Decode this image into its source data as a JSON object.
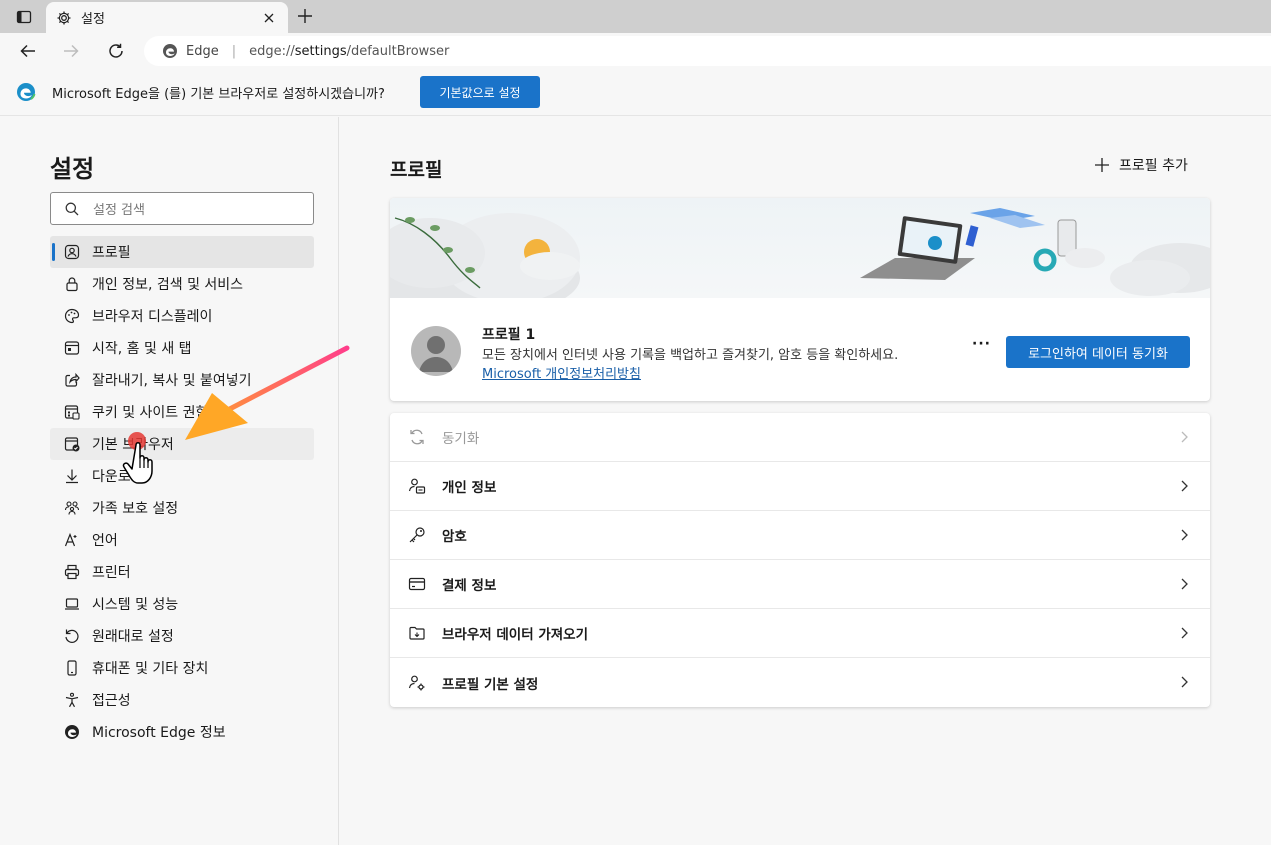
{
  "tab": {
    "title": "설정"
  },
  "address": {
    "brand": "Edge",
    "separator": "|",
    "url_prefix": "edge://",
    "url_host": "settings",
    "url_path": "/defaultBrowser"
  },
  "infobar": {
    "message": "Microsoft Edge을 (를) 기본 브라우저로 설정하시겠습니까?",
    "button": "기본값으로 설정"
  },
  "sidebar": {
    "title": "설정",
    "search_placeholder": "설정 검색",
    "items": [
      {
        "label": "프로필",
        "icon": "profile-icon"
      },
      {
        "label": "개인 정보, 검색 및 서비스",
        "icon": "lock-icon"
      },
      {
        "label": "브라우저 디스플레이",
        "icon": "palette-icon"
      },
      {
        "label": "시작, 홈 및 새 탭",
        "icon": "home-tab-icon"
      },
      {
        "label": "잘라내기, 복사 및 붙여넣기",
        "icon": "share-icon"
      },
      {
        "label": "쿠키 및 사이트 권한",
        "icon": "cookie-icon"
      },
      {
        "label": "기본 브라우저",
        "icon": "browser-check-icon"
      },
      {
        "label": "다운로드",
        "icon": "download-icon"
      },
      {
        "label": "가족 보호 설정",
        "icon": "family-icon"
      },
      {
        "label": "언어",
        "icon": "language-icon"
      },
      {
        "label": "프린터",
        "icon": "printer-icon"
      },
      {
        "label": "시스템 및 성능",
        "icon": "laptop-icon"
      },
      {
        "label": "원래대로 설정",
        "icon": "reset-icon"
      },
      {
        "label": "휴대폰 및 기타 장치",
        "icon": "phone-icon"
      },
      {
        "label": "접근성",
        "icon": "accessibility-icon"
      },
      {
        "label": "Microsoft Edge 정보",
        "icon": "edge-icon"
      }
    ]
  },
  "main": {
    "title": "프로필",
    "add_profile": "프로필 추가",
    "profile": {
      "name": "프로필 1",
      "description": "모든 장치에서 인터넷 사용 기록을 백업하고 즐겨찾기, 암호 등을 확인하세요.",
      "link": "Microsoft 개인정보처리방침",
      "more": "···",
      "sync_button": "로그인하여 데이터 동기화"
    },
    "rows": [
      {
        "label": "동기화",
        "icon": "sync-icon"
      },
      {
        "label": "개인 정보",
        "icon": "personal-info-icon"
      },
      {
        "label": "암호",
        "icon": "key-icon"
      },
      {
        "label": "결제 정보",
        "icon": "card-icon"
      },
      {
        "label": "브라우저 데이터 가져오기",
        "icon": "import-icon"
      },
      {
        "label": "프로필 기본 설정",
        "icon": "profile-settings-icon"
      }
    ]
  },
  "colors": {
    "accent": "#1a73c9",
    "arrow_start": "#ff3d8b",
    "arrow_end": "#ffa726",
    "click_dot": "#e53935"
  }
}
